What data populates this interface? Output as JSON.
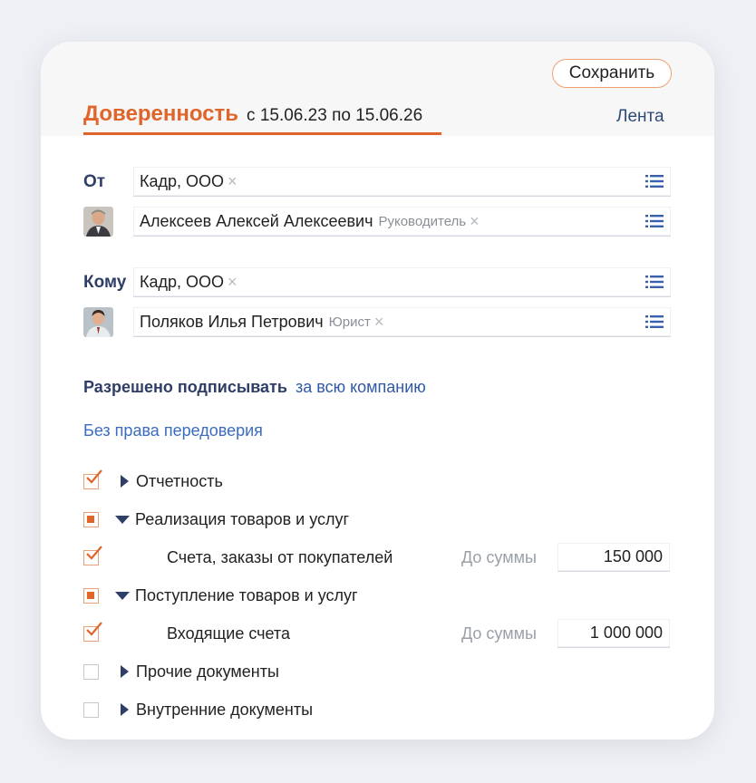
{
  "header": {
    "save_label": "Сохранить",
    "title": "Доверенность",
    "period": "с 15.06.23 по 15.06.26",
    "feed_link": "Лента"
  },
  "from": {
    "label": "От",
    "org": "Кадр, ООО",
    "person": "Алексеев Алексей Алексеевич",
    "person_role": "Руководитель"
  },
  "to": {
    "label": "Кому",
    "org": "Кадр, ООО",
    "person": "Поляков Илья Петрович",
    "person_role": "Юрист"
  },
  "permissions": {
    "allowed_label": "Разрешено подписывать",
    "allowed_scope": "за всю компанию",
    "no_redelegation": "Без права передоверия"
  },
  "tree": [
    {
      "label": "Отчетность",
      "state": "checked",
      "expand": "collapsed"
    },
    {
      "label": "Реализация товаров и услуг",
      "state": "partial",
      "expand": "expanded"
    },
    {
      "label": "Счета, заказы от покупателей",
      "state": "checked",
      "sum_label": "До суммы",
      "sum": "150 000"
    },
    {
      "label": "Поступление товаров и услуг",
      "state": "partial",
      "expand": "expanded"
    },
    {
      "label": "Входящие счета",
      "state": "checked",
      "sum_label": "До суммы",
      "sum": "1 000 000"
    },
    {
      "label": "Прочие документы",
      "state": "unchecked",
      "expand": "collapsed"
    },
    {
      "label": "Внутренние документы",
      "state": "unchecked",
      "expand": "collapsed"
    }
  ],
  "colors": {
    "accent": "#e0652a",
    "label_blue": "#2f3e66",
    "link_blue": "#3a6cc0"
  },
  "icons": [
    "list-icon",
    "close-icon",
    "checkmark-icon",
    "triangle-right-icon",
    "triangle-down-icon"
  ]
}
